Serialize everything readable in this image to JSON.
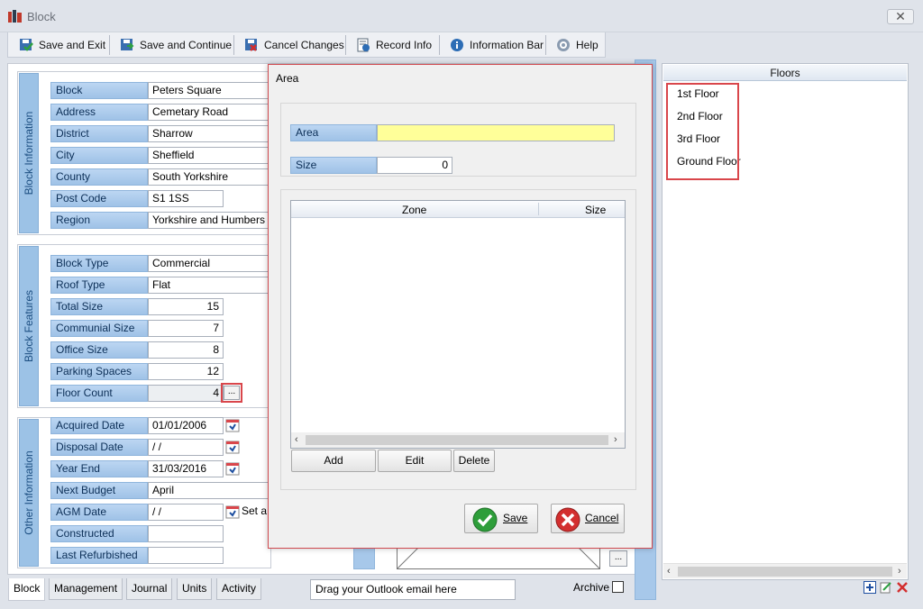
{
  "window": {
    "title": "Block",
    "close_glyph": "✕"
  },
  "toolbar": {
    "buttons": [
      {
        "label": "Save and Exit",
        "icon": "save-exit-icon"
      },
      {
        "label": "Save and Continue",
        "icon": "save-continue-icon"
      },
      {
        "label": "Cancel Changes",
        "icon": "cancel-changes-icon"
      },
      {
        "label": "Record Info",
        "icon": "record-info-icon"
      },
      {
        "label": "Information Bar",
        "icon": "info-icon"
      },
      {
        "label": "Help",
        "icon": "help-icon"
      }
    ]
  },
  "block_information": {
    "title": "Block Information",
    "fields": [
      {
        "label": "Block",
        "value": "Peters Square"
      },
      {
        "label": "Address",
        "value": "Cemetary Road"
      },
      {
        "label": "District",
        "value": "Sharrow"
      },
      {
        "label": "City",
        "value": "Sheffield"
      },
      {
        "label": "County",
        "value": "South Yorkshire"
      },
      {
        "label": "Post Code",
        "value": "S1 1SS"
      },
      {
        "label": "Region",
        "value": "Yorkshire and Humbers"
      }
    ]
  },
  "block_features": {
    "title": "Block Features",
    "fields": [
      {
        "label": "Block Type",
        "value": "Commercial"
      },
      {
        "label": "Roof Type",
        "value": "Flat"
      },
      {
        "label": "Total Size",
        "value": "15"
      },
      {
        "label": "Communial Size",
        "value": "7"
      },
      {
        "label": "Office Size",
        "value": "8"
      },
      {
        "label": "Parking Spaces",
        "value": "12"
      },
      {
        "label": "Floor Count",
        "value": "4"
      }
    ],
    "ellipsis": "..."
  },
  "other_information": {
    "title": "Other Information",
    "fields": [
      {
        "label": "Acquired Date",
        "value": "01/01/2006"
      },
      {
        "label": "Disposal Date",
        "value": " / /"
      },
      {
        "label": "Year End",
        "value": "31/03/2016"
      },
      {
        "label": "Next Budget",
        "value": "April"
      },
      {
        "label": "AGM Date",
        "value": " / /"
      },
      {
        "label": "Constructed",
        "value": ""
      },
      {
        "label": "Last Refurbished",
        "value": ""
      }
    ],
    "agm_suffix": "Set a"
  },
  "bottom": {
    "tabs": [
      "Block",
      "Management",
      "Journal",
      "Units",
      "Activity"
    ],
    "drop_zone": "Drag your Outlook email here",
    "archive_label": "Archive",
    "ellipsis": "..."
  },
  "floors": {
    "header": "Floors",
    "items": [
      "1st Floor",
      "2nd Floor",
      "3rd Floor",
      "Ground Floor"
    ]
  },
  "dialog": {
    "title": "Area",
    "area_label": "Area",
    "area_value": "",
    "size_label": "Size",
    "size_value": "0",
    "columns": [
      "Zone",
      "Size"
    ],
    "add": "Add",
    "edit": "Edit",
    "delete": "Delete",
    "save": "Save",
    "cancel": "Cancel"
  },
  "colors": {
    "accent_label": "#a7c8ea",
    "highlight": "#d9464b",
    "area_input": "#ffff99"
  }
}
